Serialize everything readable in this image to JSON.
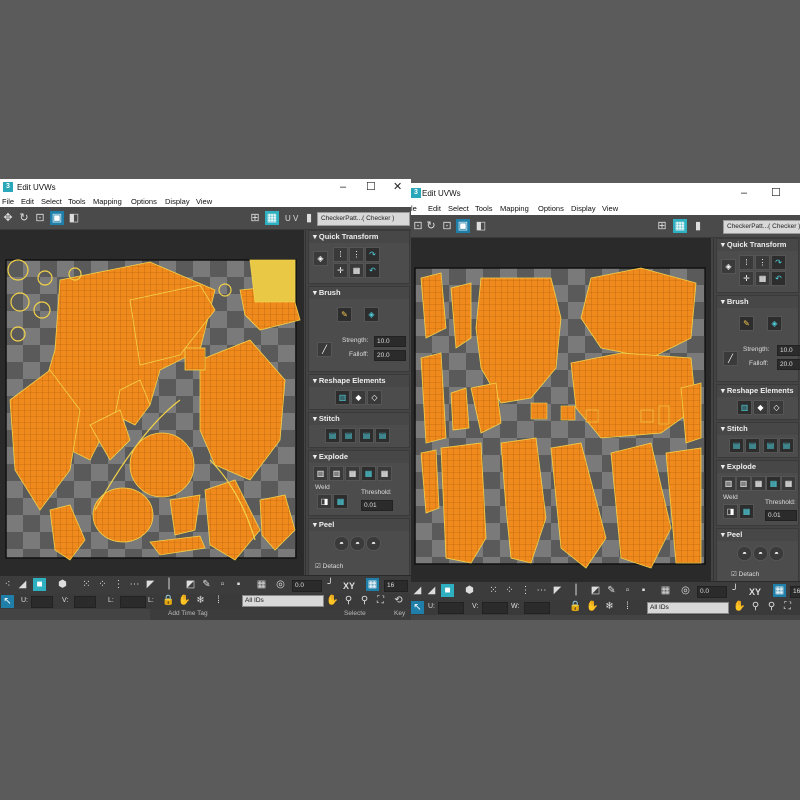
{
  "windows": [
    {
      "title": "Edit UVWs",
      "menu": [
        "File",
        "Edit",
        "Select",
        "Tools",
        "Mapping",
        "Options",
        "Display",
        "View"
      ],
      "uv_label": "U V",
      "texture_selector": "CheckerPatt...( Checker )",
      "panel": {
        "quick_transform": "Quick Transform",
        "brush": "Brush",
        "strength_label": "Strength:",
        "strength_value": "10.0",
        "falloff_label": "Falloff:",
        "falloff_value": "20.0",
        "reshape": "Reshape Elements",
        "stitch": "Stitch",
        "explode": "Explode",
        "weld": "Weld",
        "threshold_label": "Threshold:",
        "threshold_value": "0.01",
        "peel": "Peel",
        "detach": "Detach"
      },
      "bottom": {
        "angle_value": "0.0",
        "xy_label": "XY",
        "grid_value": "16",
        "u_label": "U:",
        "v_label": "V:",
        "w_label": "L:",
        "ids_select": "All IDs",
        "status_left": "Add Time Tag",
        "status_right_1": "Selecte",
        "status_right_2": "Key"
      }
    },
    {
      "title": "Edit UVWs",
      "menu": [
        "le",
        "Edit",
        "Select",
        "Tools",
        "Mapping",
        "Options",
        "Display",
        "View"
      ],
      "texture_selector": "CheckerPatt...( Checker )",
      "panel": {
        "quick_transform": "Quick Transform",
        "brush": "Brush",
        "strength_label": "Strength:",
        "strength_value": "10.0",
        "falloff_label": "Falloff:",
        "falloff_value": "20.0",
        "reshape": "Reshape Elements",
        "stitch": "Stitch",
        "explode": "Explode",
        "weld": "Weld",
        "threshold_label": "Threshold:",
        "threshold_value": "0.01",
        "peel": "Peel",
        "detach": "Detach"
      },
      "bottom": {
        "angle_value": "0.0",
        "xy_label": "XY",
        "grid_value": "16",
        "u_label": "U:",
        "v_label": "V:",
        "w_label": "W:",
        "ids_select": "All IDs"
      }
    }
  ],
  "colors": {
    "uv_orange": "#f08a1c",
    "uv_edge_yellow": "#f2d24a",
    "accent_teal": "#2fb0c0",
    "accent_blue": "#1f7fa8"
  }
}
